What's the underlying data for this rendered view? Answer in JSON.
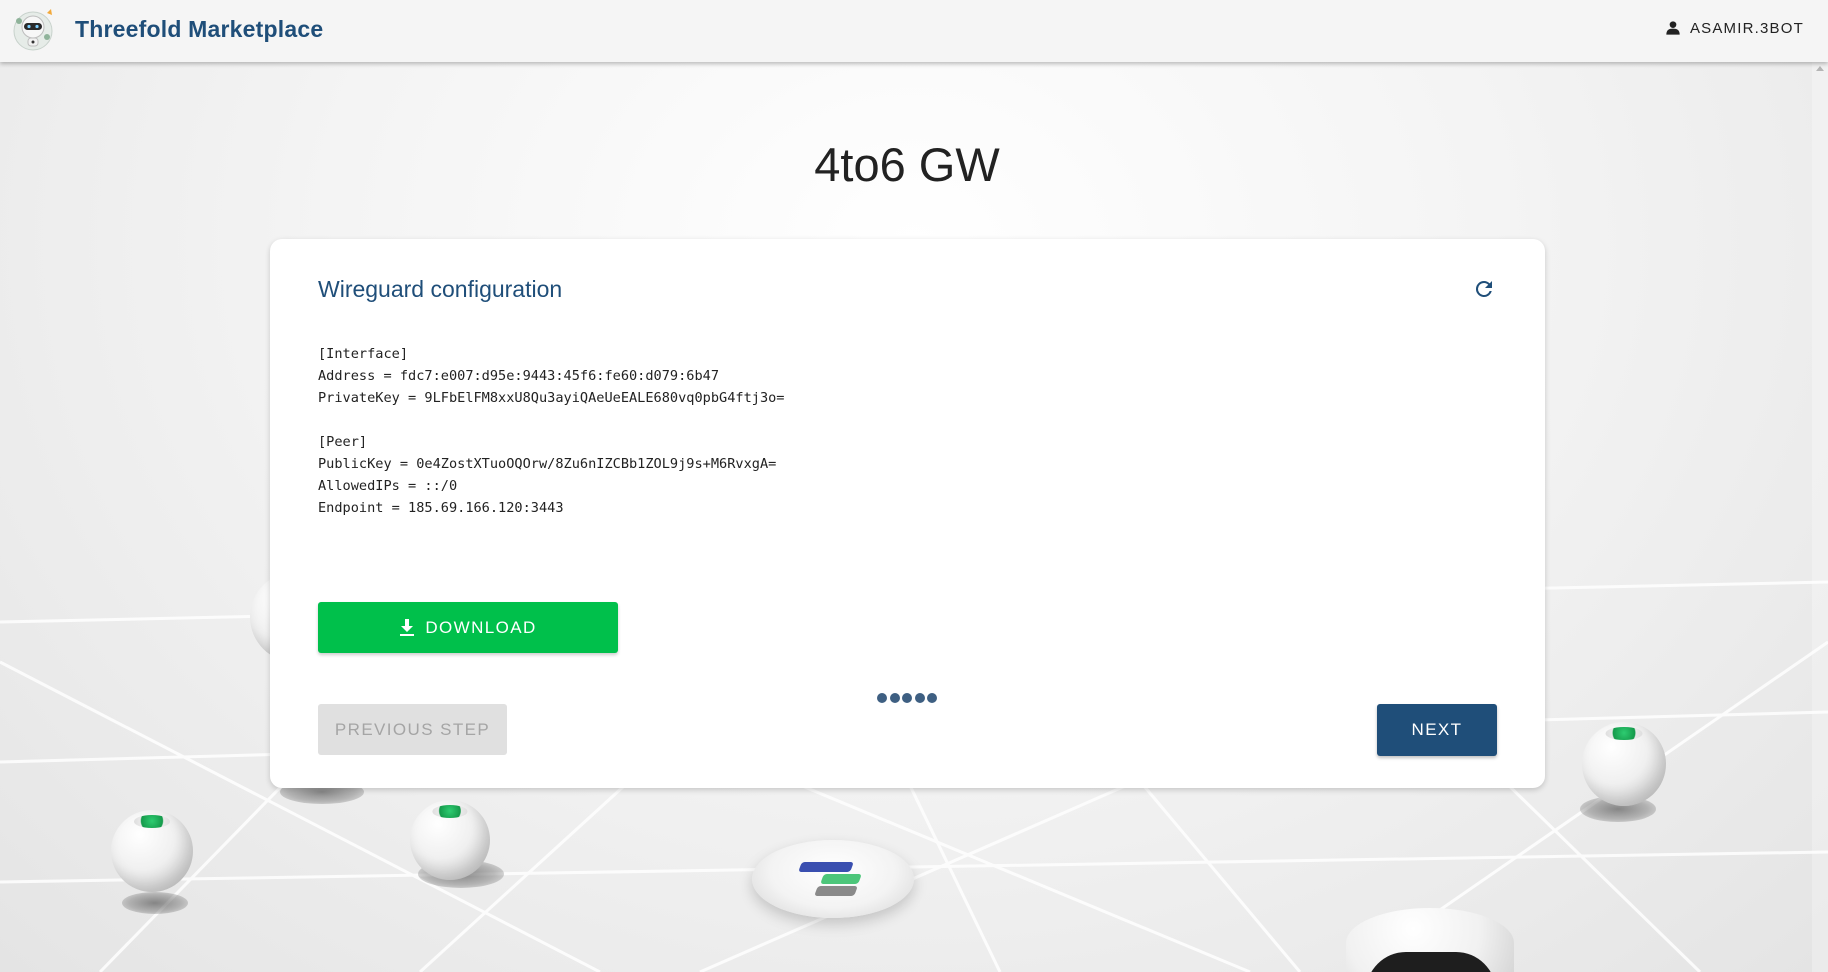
{
  "header": {
    "app_title": "Threefold Marketplace",
    "user": {
      "icon": "person-icon",
      "name": "ASAMIR.3BOT"
    }
  },
  "page": {
    "title": "4to6 GW"
  },
  "card": {
    "title": "Wireguard configuration",
    "refresh_icon": "refresh-icon",
    "config_lines": [
      "[Interface]",
      "Address = fdc7:e007:d95e:9443:45f6:fe60:d079:6b47",
      "PrivateKey = 9LFbElFM8xxU8Qu3ayiQAeUeEALE680vq0pbG4ftj3o=",
      "",
      "[Peer]",
      "PublicKey = 0e4ZostXTuoOQOrw/8Zu6nIZCBb1ZOL9j9s+M6RvxgA=",
      "AllowedIPs = ::/0",
      "Endpoint = 185.69.166.120:3443"
    ],
    "download": {
      "icon": "download-icon",
      "label": "DOWNLOAD"
    },
    "previous_label": "PREVIOUS STEP",
    "next_label": "NEXT",
    "steps": [
      {
        "step": 1
      },
      {
        "step": 2
      },
      {
        "step": 3
      },
      {
        "step": 4
      },
      {
        "step": 5
      }
    ]
  },
  "colors": {
    "brand": "#1f4e79",
    "download_green": "#00c04b",
    "step_dot": "#3e5f82",
    "disabled_bg": "#e0e0e0"
  }
}
